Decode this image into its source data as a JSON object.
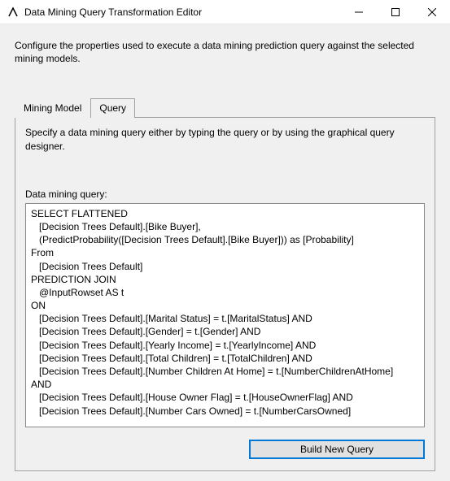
{
  "window": {
    "title": "Data Mining Query Transformation Editor"
  },
  "page": {
    "description": "Configure the properties used to execute a data mining prediction query against the selected mining models."
  },
  "tabs": {
    "mining_model": "Mining Model",
    "query": "Query"
  },
  "query_tab": {
    "description": "Specify a data mining query either by typing the query or by using the graphical query designer.",
    "field_label": "Data mining query:",
    "query_text": "SELECT FLATTENED\n   [Decision Trees Default].[Bike Buyer],\n   (PredictProbability([Decision Trees Default].[Bike Buyer])) as [Probability]\nFrom\n   [Decision Trees Default]\nPREDICTION JOIN\n   @InputRowset AS t\nON\n   [Decision Trees Default].[Marital Status] = t.[MaritalStatus] AND\n   [Decision Trees Default].[Gender] = t.[Gender] AND\n   [Decision Trees Default].[Yearly Income] = t.[YearlyIncome] AND\n   [Decision Trees Default].[Total Children] = t.[TotalChildren] AND\n   [Decision Trees Default].[Number Children At Home] = t.[NumberChildrenAtHome]\nAND\n   [Decision Trees Default].[House Owner Flag] = t.[HouseOwnerFlag] AND\n   [Decision Trees Default].[Number Cars Owned] = t.[NumberCarsOwned]",
    "build_button": "Build New Query"
  }
}
